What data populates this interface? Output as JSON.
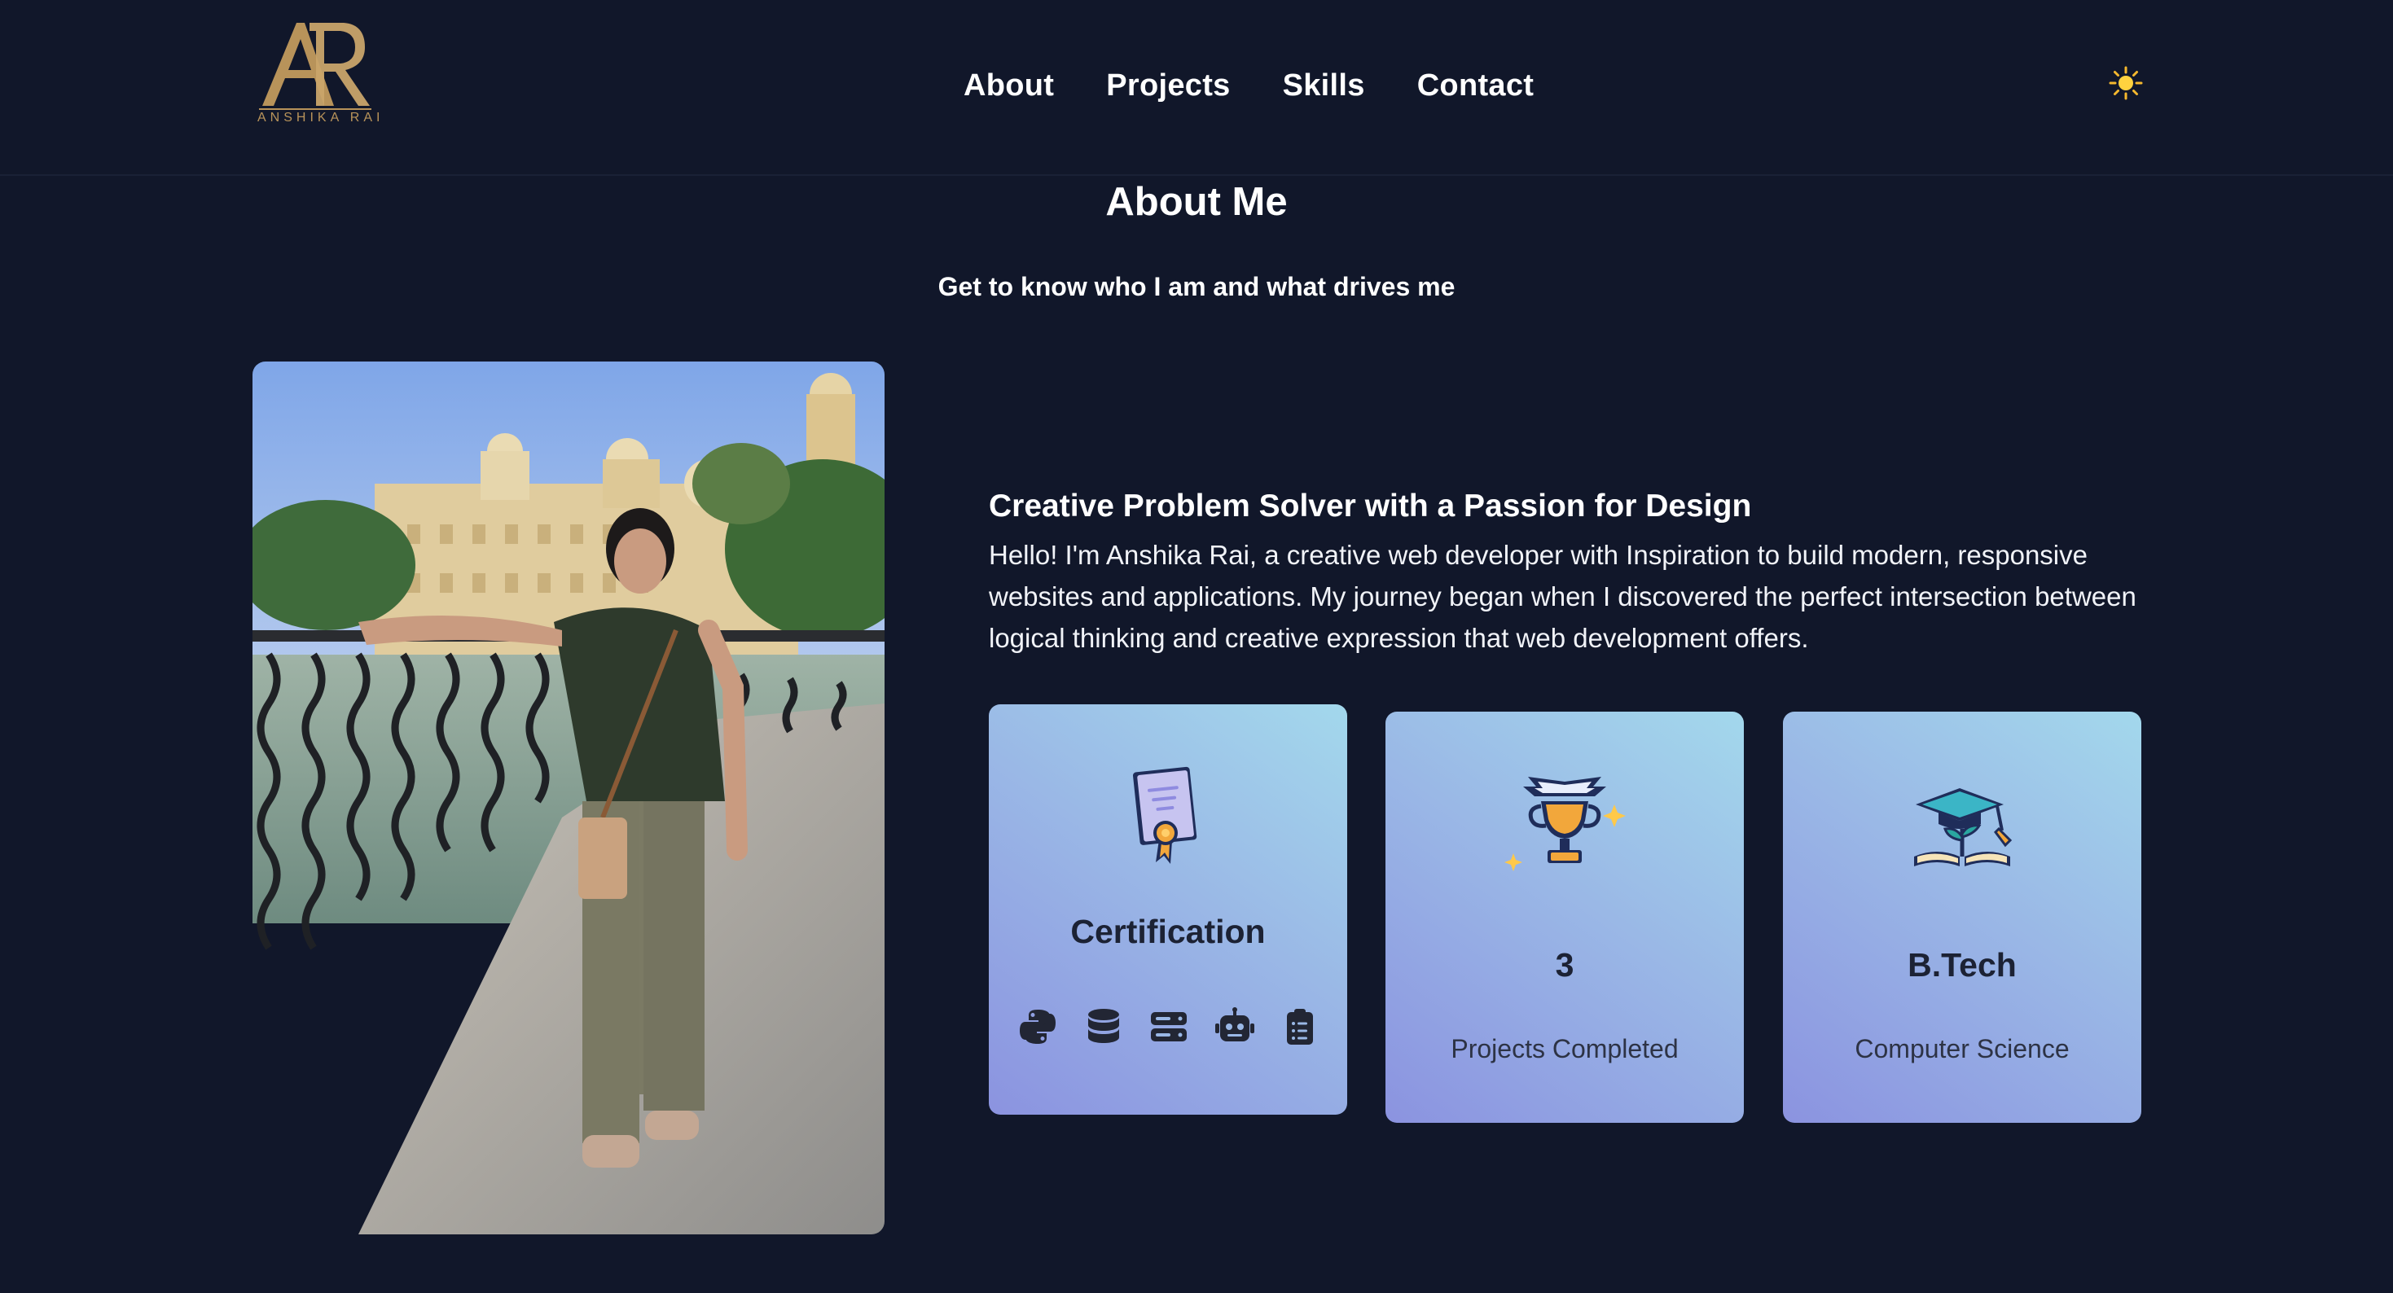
{
  "brand": {
    "monogram": "AR",
    "name": "ANSHIKA RAI",
    "color": "#b8935a"
  },
  "nav": {
    "items": [
      {
        "label": "About"
      },
      {
        "label": "Projects"
      },
      {
        "label": "Skills"
      },
      {
        "label": "Contact"
      }
    ],
    "theme_icon": "sun-icon"
  },
  "section": {
    "title": "About Me",
    "subtitle": "Get to know who I am and what drives me"
  },
  "about": {
    "heading": "Creative Problem Solver with a Passion for Design",
    "body": "Hello! I'm Anshika Rai, a creative web developer with Inspiration to build modern, responsive websites and applications. My journey began when I discovered the perfect intersection between logical thinking and creative expression that web development offers."
  },
  "cards": [
    {
      "icon": "certificate-icon",
      "title": "Certification",
      "skill_icons": [
        "python-icon",
        "database-icon",
        "server-icon",
        "robot-icon",
        "clipboard-icon"
      ]
    },
    {
      "icon": "trophy-icon",
      "title": "3",
      "label": "Projects Completed"
    },
    {
      "icon": "graduation-cap-icon",
      "title": "B.Tech",
      "label": "Computer Science"
    }
  ],
  "colors": {
    "background": "#11172a",
    "card_gradient_start": "#a3d8ec",
    "card_gradient_end": "#8b93e0",
    "text": "#ffffff"
  }
}
